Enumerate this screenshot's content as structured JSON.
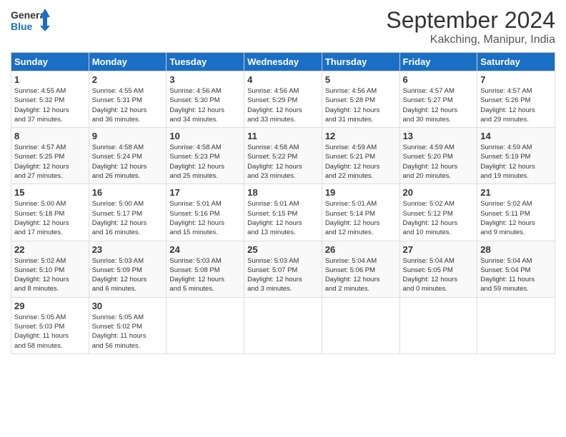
{
  "logo": {
    "line1": "General",
    "line2": "Blue"
  },
  "title": "September 2024",
  "subtitle": "Kakching, Manipur, India",
  "days_header": [
    "Sunday",
    "Monday",
    "Tuesday",
    "Wednesday",
    "Thursday",
    "Friday",
    "Saturday"
  ],
  "weeks": [
    [
      {
        "num": "1",
        "info": "Sunrise: 4:55 AM\nSunset: 5:32 PM\nDaylight: 12 hours\nand 37 minutes."
      },
      {
        "num": "2",
        "info": "Sunrise: 4:55 AM\nSunset: 5:31 PM\nDaylight: 12 hours\nand 36 minutes."
      },
      {
        "num": "3",
        "info": "Sunrise: 4:56 AM\nSunset: 5:30 PM\nDaylight: 12 hours\nand 34 minutes."
      },
      {
        "num": "4",
        "info": "Sunrise: 4:56 AM\nSunset: 5:29 PM\nDaylight: 12 hours\nand 33 minutes."
      },
      {
        "num": "5",
        "info": "Sunrise: 4:56 AM\nSunset: 5:28 PM\nDaylight: 12 hours\nand 31 minutes."
      },
      {
        "num": "6",
        "info": "Sunrise: 4:57 AM\nSunset: 5:27 PM\nDaylight: 12 hours\nand 30 minutes."
      },
      {
        "num": "7",
        "info": "Sunrise: 4:57 AM\nSunset: 5:26 PM\nDaylight: 12 hours\nand 29 minutes."
      }
    ],
    [
      {
        "num": "8",
        "info": "Sunrise: 4:57 AM\nSunset: 5:25 PM\nDaylight: 12 hours\nand 27 minutes."
      },
      {
        "num": "9",
        "info": "Sunrise: 4:58 AM\nSunset: 5:24 PM\nDaylight: 12 hours\nand 26 minutes."
      },
      {
        "num": "10",
        "info": "Sunrise: 4:58 AM\nSunset: 5:23 PM\nDaylight: 12 hours\nand 25 minutes."
      },
      {
        "num": "11",
        "info": "Sunrise: 4:58 AM\nSunset: 5:22 PM\nDaylight: 12 hours\nand 23 minutes."
      },
      {
        "num": "12",
        "info": "Sunrise: 4:59 AM\nSunset: 5:21 PM\nDaylight: 12 hours\nand 22 minutes."
      },
      {
        "num": "13",
        "info": "Sunrise: 4:59 AM\nSunset: 5:20 PM\nDaylight: 12 hours\nand 20 minutes."
      },
      {
        "num": "14",
        "info": "Sunrise: 4:59 AM\nSunset: 5:19 PM\nDaylight: 12 hours\nand 19 minutes."
      }
    ],
    [
      {
        "num": "15",
        "info": "Sunrise: 5:00 AM\nSunset: 5:18 PM\nDaylight: 12 hours\nand 17 minutes."
      },
      {
        "num": "16",
        "info": "Sunrise: 5:00 AM\nSunset: 5:17 PM\nDaylight: 12 hours\nand 16 minutes."
      },
      {
        "num": "17",
        "info": "Sunrise: 5:01 AM\nSunset: 5:16 PM\nDaylight: 12 hours\nand 15 minutes."
      },
      {
        "num": "18",
        "info": "Sunrise: 5:01 AM\nSunset: 5:15 PM\nDaylight: 12 hours\nand 13 minutes."
      },
      {
        "num": "19",
        "info": "Sunrise: 5:01 AM\nSunset: 5:14 PM\nDaylight: 12 hours\nand 12 minutes."
      },
      {
        "num": "20",
        "info": "Sunrise: 5:02 AM\nSunset: 5:12 PM\nDaylight: 12 hours\nand 10 minutes."
      },
      {
        "num": "21",
        "info": "Sunrise: 5:02 AM\nSunset: 5:11 PM\nDaylight: 12 hours\nand 9 minutes."
      }
    ],
    [
      {
        "num": "22",
        "info": "Sunrise: 5:02 AM\nSunset: 5:10 PM\nDaylight: 12 hours\nand 8 minutes."
      },
      {
        "num": "23",
        "info": "Sunrise: 5:03 AM\nSunset: 5:09 PM\nDaylight: 12 hours\nand 6 minutes."
      },
      {
        "num": "24",
        "info": "Sunrise: 5:03 AM\nSunset: 5:08 PM\nDaylight: 12 hours\nand 5 minutes."
      },
      {
        "num": "25",
        "info": "Sunrise: 5:03 AM\nSunset: 5:07 PM\nDaylight: 12 hours\nand 3 minutes."
      },
      {
        "num": "26",
        "info": "Sunrise: 5:04 AM\nSunset: 5:06 PM\nDaylight: 12 hours\nand 2 minutes."
      },
      {
        "num": "27",
        "info": "Sunrise: 5:04 AM\nSunset: 5:05 PM\nDaylight: 12 hours\nand 0 minutes."
      },
      {
        "num": "28",
        "info": "Sunrise: 5:04 AM\nSunset: 5:04 PM\nDaylight: 11 hours\nand 59 minutes."
      }
    ],
    [
      {
        "num": "29",
        "info": "Sunrise: 5:05 AM\nSunset: 5:03 PM\nDaylight: 11 hours\nand 58 minutes."
      },
      {
        "num": "30",
        "info": "Sunrise: 5:05 AM\nSunset: 5:02 PM\nDaylight: 11 hours\nand 56 minutes."
      },
      {
        "num": "",
        "info": ""
      },
      {
        "num": "",
        "info": ""
      },
      {
        "num": "",
        "info": ""
      },
      {
        "num": "",
        "info": ""
      },
      {
        "num": "",
        "info": ""
      }
    ]
  ]
}
